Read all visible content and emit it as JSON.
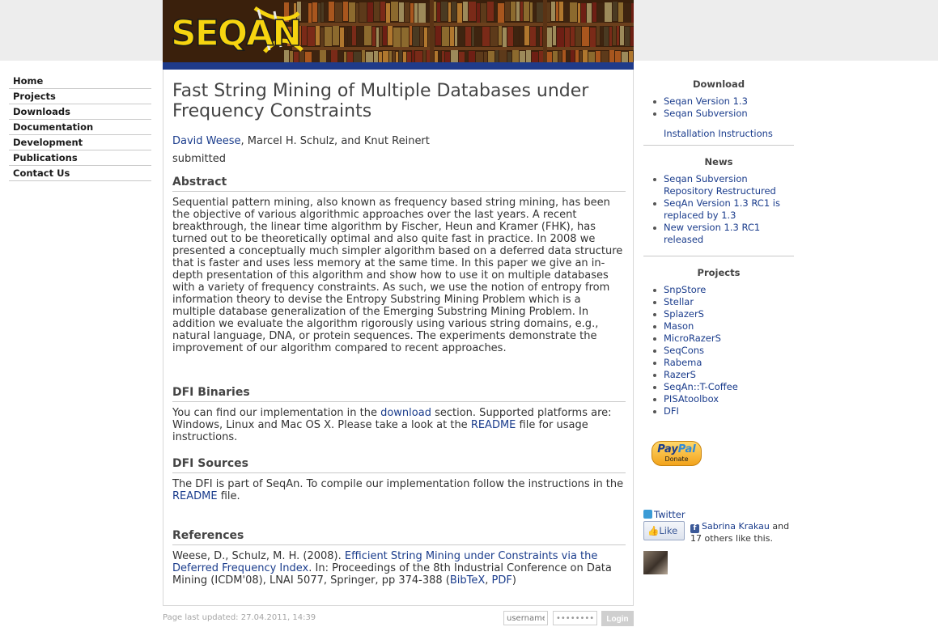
{
  "header": {
    "logo_text": "SEQAN"
  },
  "nav": {
    "items": [
      {
        "label": "Home"
      },
      {
        "label": "Projects"
      },
      {
        "label": "Downloads"
      },
      {
        "label": "Documentation"
      },
      {
        "label": "Development"
      },
      {
        "label": "Publications"
      },
      {
        "label": "Contact Us"
      }
    ]
  },
  "main": {
    "title": "Fast String Mining of Multiple Databases under Frequency Constraints",
    "authors_link": "David Weese",
    "authors_rest": ", Marcel H. Schulz, and Knut Reinert",
    "status": "submitted",
    "abstract_heading": "Abstract",
    "abstract_text": "Sequential pattern mining, also known as frequency based string mining, has been the objective of various algorithmic approaches over the last years. A recent breakthrough, the linear time algorithm by Fischer, Heun and Kramer (FHK), has turned out to be theoretically optimal and also quite fast in practice. In 2008 we presented a conceptually much simpler algorithm based on a deferred data structure that is faster and uses less memory at the same time. In this paper we give an in-depth presentation of this algorithm and show how to use it on multiple databases with a variety of frequency constraints. As such, we use the notion of entropy from information theory to devise the Entropy Substring Mining Problem which is a multiple database generalization of the Emerging Substring Mining Problem. In addition we evaluate the algorithm rigorously using various string domains, e.g., natural language, DNA, or protein sequences. The experiments demonstrate the improvement of our algorithm compared to recent approaches.",
    "binaries_heading": "DFI Binaries",
    "binaries_text_1": "You can find our implementation in the ",
    "binaries_link_download": "download",
    "binaries_text_2": " section. Supported platforms are: Windows, Linux and Mac OS X. Please take a look at the ",
    "binaries_link_readme": "README",
    "binaries_text_3": " file for usage instructions.",
    "sources_heading": "DFI Sources",
    "sources_text_1": "The DFI is part of SeqAn. To compile our implementation follow the instructions in the ",
    "sources_link_readme": "README",
    "sources_text_2": " file.",
    "references_heading": "References",
    "ref_text_1": "Weese, D., Schulz, M. H. (2008). ",
    "ref_link_title": "Efficient String Mining under Constraints via the Deferred Frequency Index",
    "ref_text_2": ". In: Proceedings of the 8th Industrial Conference on Data Mining (ICDM'08), LNAI 5077, Springer, pp 374-388 (",
    "ref_link_bibtex": "BibTeX",
    "ref_text_sep": ", ",
    "ref_link_pdf": "PDF",
    "ref_text_3": ")"
  },
  "sidebar": {
    "download_heading": "Download",
    "download_items": [
      {
        "label": "Seqan Version 1.3"
      },
      {
        "label": "Seqan Subversion"
      }
    ],
    "install_link": "Installation Instructions",
    "news_heading": "News",
    "news_items": [
      {
        "label": "Seqan Subversion Repository Restructured"
      },
      {
        "label": "SeqAn Version 1.3 RC1 is replaced by 1.3"
      },
      {
        "label": "New version 1.3 RC1 released"
      }
    ],
    "projects_heading": "Projects",
    "project_items": [
      {
        "label": "SnpStore"
      },
      {
        "label": "Stellar"
      },
      {
        "label": "SplazerS"
      },
      {
        "label": "Mason"
      },
      {
        "label": "MicroRazerS"
      },
      {
        "label": "SeqCons"
      },
      {
        "label": "Rabema"
      },
      {
        "label": "RazerS"
      },
      {
        "label": "SeqAn::T-Coffee"
      },
      {
        "label": "PISAtoolbox"
      },
      {
        "label": "DFI"
      }
    ],
    "paypal_pay": "Pay",
    "paypal_pal": "Pal",
    "paypal_donate": "Donate",
    "twitter_label": "Twitter",
    "like_label": "Like",
    "fb_name": "Sabrina Krakau",
    "fb_rest": " and 17 others like this."
  },
  "footer": {
    "last_updated": "Page last updated: 27.04.2011, 14:39",
    "username_placeholder": "username",
    "password_mask": "••••••••",
    "login_label": "Login"
  },
  "colors": {
    "link": "#1a3c8c",
    "logo_yellow": "#f6d410",
    "banner_strip": "#1f3b8a"
  }
}
